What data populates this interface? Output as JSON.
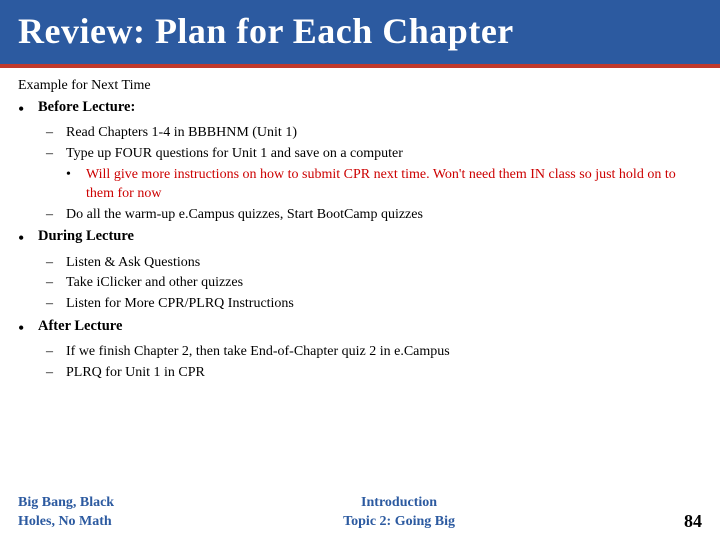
{
  "header": {
    "title": "Review: Plan for Each Chapter",
    "bg_color": "#2c5aa0"
  },
  "content": {
    "example_label": "Example for Next Time",
    "sections": [
      {
        "id": "before-lecture",
        "label": "Before Lecture:",
        "items": [
          {
            "text": "Read Chapters 1-4 in BBBHNM (Unit 1)",
            "sub_items": []
          },
          {
            "text": "Type up FOUR questions for Unit 1 and save on a computer",
            "sub_items": [
              {
                "text_normal": "",
                "text_red": "Will give more instructions on how to submit CPR next time. Won't need them IN class so just hold on to them for now"
              }
            ]
          },
          {
            "text": "Do all the warm-up e.Campus quizzes, Start BootCamp quizzes",
            "sub_items": []
          }
        ]
      },
      {
        "id": "during-lecture",
        "label": "During Lecture",
        "items": [
          {
            "text": "Listen & Ask Questions",
            "sub_items": []
          },
          {
            "text": "Take iClicker and other quizzes",
            "sub_items": []
          },
          {
            "text": "Listen for More CPR/PLRQ Instructions",
            "sub_items": []
          }
        ]
      },
      {
        "id": "after-lecture",
        "label": "After Lecture",
        "items": [
          {
            "text": "If we finish Chapter 2, then take End-of-Chapter quiz 2 in e.Campus",
            "sub_items": []
          },
          {
            "text": "PLRQ for Unit 1 in CPR",
            "sub_items": []
          }
        ]
      }
    ]
  },
  "footer": {
    "left_line1": "Big Bang, Black",
    "left_line2": "Holes, No Math",
    "center_line1": "Introduction",
    "center_line2": "Topic 2: Going Big",
    "page_number": "84"
  }
}
